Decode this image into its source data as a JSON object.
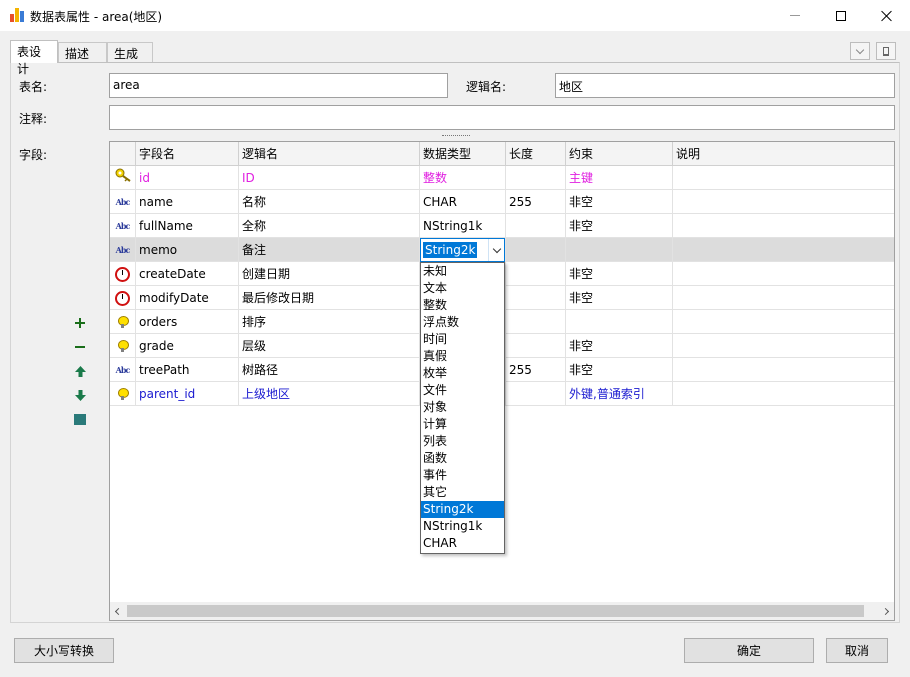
{
  "window": {
    "title": "数据表属性 - area(地区)"
  },
  "tabs": [
    {
      "label": "表设计",
      "active": true
    },
    {
      "label": "描述",
      "active": false
    },
    {
      "label": "生成",
      "active": false
    }
  ],
  "form": {
    "table_name_label": "表名:",
    "table_name_value": "area",
    "logic_name_label": "逻辑名:",
    "logic_name_value": "地区",
    "comment_label": "注释:",
    "comment_value": "",
    "fields_label": "字段:"
  },
  "grid": {
    "columns": [
      "字段名",
      "逻辑名",
      "数据类型",
      "长度",
      "约束",
      "说明"
    ],
    "rows": [
      {
        "icon": "key-icon",
        "name": "id",
        "logic": "ID",
        "type": "整数",
        "length": "",
        "constraint": "主键",
        "desc": "",
        "style": "pink"
      },
      {
        "icon": "abc-icon",
        "name": "name",
        "logic": "名称",
        "type": "CHAR",
        "length": "255",
        "constraint": "非空",
        "desc": "",
        "style": ""
      },
      {
        "icon": "abc-icon",
        "name": "fullName",
        "logic": "全称",
        "type": "NString1k",
        "length": "",
        "constraint": "非空",
        "desc": "",
        "style": ""
      },
      {
        "icon": "abc-icon",
        "name": "memo",
        "logic": "备注",
        "type": "String2k",
        "length": "",
        "constraint": "",
        "desc": "",
        "style": ""
      },
      {
        "icon": "clock-icon",
        "name": "createDate",
        "logic": "创建日期",
        "type": "",
        "length": "",
        "constraint": "非空",
        "desc": "",
        "style": ""
      },
      {
        "icon": "clock-icon",
        "name": "modifyDate",
        "logic": "最后修改日期",
        "type": "",
        "length": "",
        "constraint": "非空",
        "desc": "",
        "style": ""
      },
      {
        "icon": "bulb-icon",
        "name": "orders",
        "logic": "排序",
        "type": "",
        "length": "",
        "constraint": "",
        "desc": "",
        "style": ""
      },
      {
        "icon": "bulb-icon",
        "name": "grade",
        "logic": "层级",
        "type": "",
        "length": "",
        "constraint": "非空",
        "desc": "",
        "style": ""
      },
      {
        "icon": "abc-icon",
        "name": "treePath",
        "logic": "树路径",
        "type": "",
        "length": "255",
        "constraint": "非空",
        "desc": "",
        "style": ""
      },
      {
        "icon": "bulb-icon",
        "name": "parent_id",
        "logic": "上级地区",
        "type": "",
        "length": "",
        "constraint": "外键,普通索引",
        "desc": "",
        "style": "blue"
      }
    ],
    "selected_row": 3
  },
  "type_combo": {
    "value": "String2k",
    "options": [
      "未知",
      "文本",
      "整数",
      "浮点数",
      "时间",
      "真假",
      "枚举",
      "文件",
      "对象",
      "计算",
      "列表",
      "函数",
      "事件",
      "其它",
      "String2k",
      "NString1k",
      "CHAR"
    ],
    "selected_index": 14
  },
  "abc_glyph": "Abc",
  "buttons": {
    "case_convert": "大小写转换",
    "ok": "确定",
    "cancel": "取消"
  }
}
